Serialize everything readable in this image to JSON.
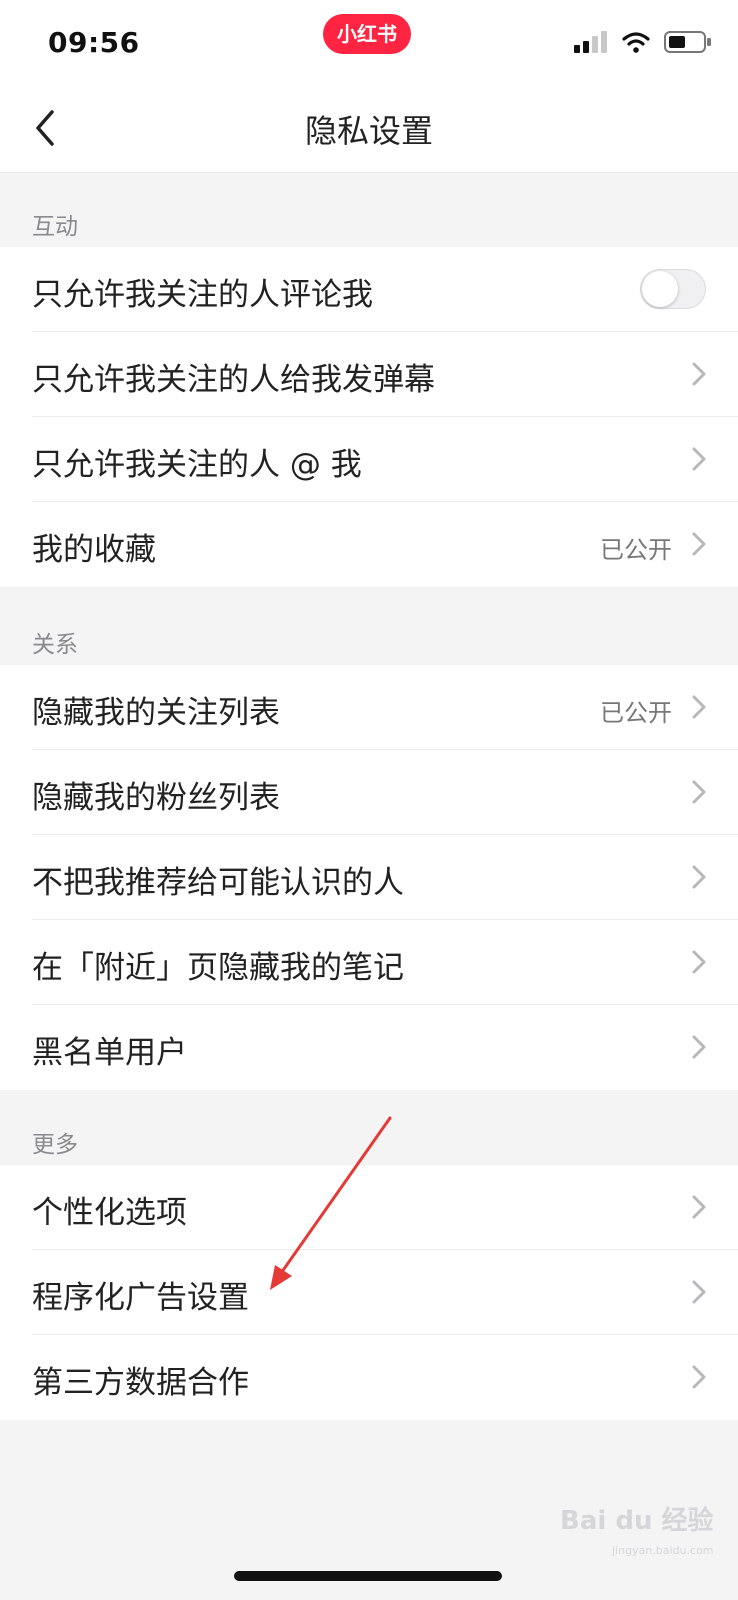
{
  "status_bar": {
    "time": "09:56",
    "app_badge": "小红书",
    "icons": [
      "signal-icon",
      "wifi-icon",
      "battery-icon"
    ]
  },
  "nav": {
    "title": "隐私设置",
    "back_icon": "chevron-left-icon"
  },
  "sections": [
    {
      "header": "互动",
      "rows": [
        {
          "label": "只允许我关注的人评论我",
          "control": "toggle",
          "toggle_on": false
        },
        {
          "label": "只允许我关注的人给我发弹幕",
          "control": "chevron"
        },
        {
          "label": "只允许我关注的人 @ 我",
          "control": "chevron"
        },
        {
          "label": "我的收藏",
          "value": "已公开",
          "control": "chevron"
        }
      ]
    },
    {
      "header": "关系",
      "rows": [
        {
          "label": "隐藏我的关注列表",
          "value": "已公开",
          "control": "chevron"
        },
        {
          "label": "隐藏我的粉丝列表",
          "control": "chevron"
        },
        {
          "label": "不把我推荐给可能认识的人",
          "control": "chevron"
        },
        {
          "label": "在「附近」页隐藏我的笔记",
          "control": "chevron"
        },
        {
          "label": "黑名单用户",
          "control": "chevron"
        }
      ]
    },
    {
      "header": "更多",
      "rows": [
        {
          "label": "个性化选项",
          "control": "chevron"
        },
        {
          "label": "程序化广告设置",
          "control": "chevron"
        },
        {
          "label": "第三方数据合作",
          "control": "chevron"
        }
      ]
    }
  ],
  "watermark": {
    "text": "Bai du 经验",
    "sub": "jingyan.baidu.com"
  },
  "colors": {
    "brand": "#ff2442",
    "annotation_arrow": "#e53935",
    "background": "#f4f4f5"
  }
}
